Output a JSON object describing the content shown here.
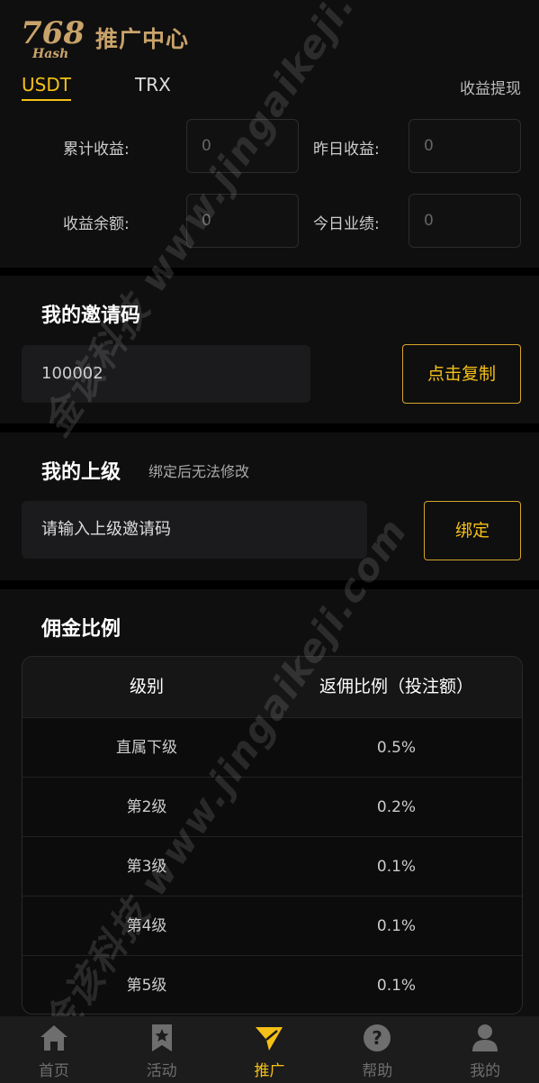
{
  "header": {
    "logo_number": "768",
    "logo_text": "Hash",
    "title": "推广中心"
  },
  "currency_tabs": [
    {
      "label": "USDT",
      "active": true
    },
    {
      "label": "TRX",
      "active": false
    }
  ],
  "withdraw_label": "收益提现",
  "stats": {
    "total_label": "累计收益:",
    "total_value": "0",
    "yesterday_label": "昨日收益:",
    "yesterday_value": "0",
    "balance_label": "收益余额:",
    "balance_value": "0",
    "today_label": "今日业绩:",
    "today_value": "0"
  },
  "invite": {
    "title": "我的邀请码",
    "code": "100002",
    "copy_label": "点击复制"
  },
  "superior": {
    "title": "我的上级",
    "note": "绑定后无法修改",
    "placeholder": "请输入上级邀请码",
    "bind_label": "绑定"
  },
  "commission": {
    "title": "佣金比例",
    "headers": [
      "级别",
      "返佣比例（投注额）"
    ],
    "rows": [
      {
        "level": "直属下级",
        "rate": "0.5%"
      },
      {
        "level": "第2级",
        "rate": "0.2%"
      },
      {
        "level": "第3级",
        "rate": "0.1%"
      },
      {
        "level": "第4级",
        "rate": "0.1%"
      },
      {
        "level": "第5级",
        "rate": "0.1%"
      }
    ]
  },
  "nav": [
    {
      "label": "首页",
      "icon": "home-icon",
      "active": false
    },
    {
      "label": "活动",
      "icon": "bookmark-star-icon",
      "active": false
    },
    {
      "label": "推广",
      "icon": "send-icon",
      "active": true
    },
    {
      "label": "帮助",
      "icon": "help-icon",
      "active": false
    },
    {
      "label": "我的",
      "icon": "user-icon",
      "active": false
    }
  ],
  "watermark": "金该科技 www.jingaikeji.com",
  "colors": {
    "accent": "#f5c017",
    "brand_gold": "#c9a36a",
    "background": "#0f0f0f"
  }
}
